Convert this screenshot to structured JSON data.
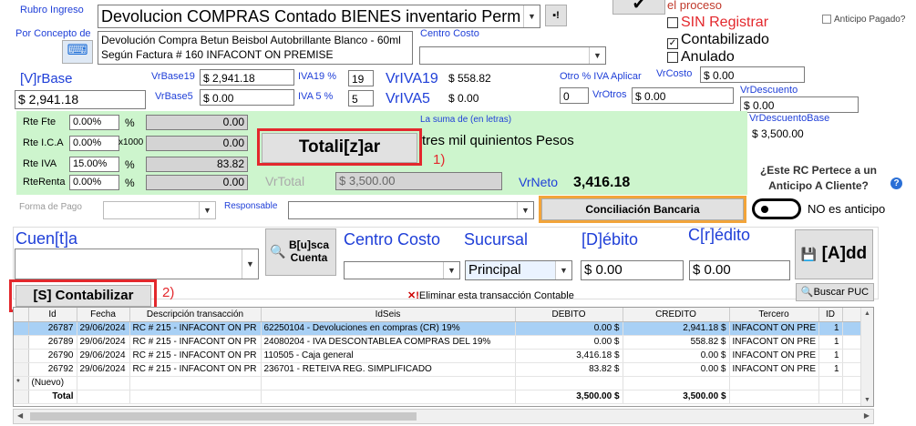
{
  "header": {
    "rubro_label": "Rubro Ingreso",
    "rubro_value": "Devolucion COMPRAS Contado BIENES inventario Perm",
    "por_concepto_label": "Por Concepto de",
    "concepto_text": "Devolución Compra Betun Beisbol Autobrillante Blanco - 60ml Según Factura # 160 INFACONT ON PREMISE",
    "centro_costo_label": "Centro Costo",
    "el_proceso": "el proceso",
    "sin_registrar": "SIN Registrar",
    "contabilizado": "Contabilizado",
    "anulado": "Anulado",
    "anticipo_pagado": "Anticipo Pagado?"
  },
  "values": {
    "vrbase_label": "[V]rBase",
    "vrbase_value": "$ 2,941.18",
    "vrbase19_label": "VrBase19",
    "vrbase19_value": "$ 2,941.18",
    "vrbase5_label": "VrBase5",
    "vrbase5_value": "$ 0.00",
    "iva19_label": "IVA19 %",
    "iva19_value": "19",
    "iva5_label": "IVA 5 %",
    "iva5_value": "5",
    "vriva19_label": "VrIVA19",
    "vriva19_value": "$ 558.82",
    "vriva5_label": "VrIVA5",
    "vriva5_value": "$ 0.00",
    "otro_iva_label": "Otro % IVA Aplicar",
    "otro_iva_value": "0",
    "vrcosto_label": "VrCosto",
    "vrcosto_value": "$ 0.00",
    "vrotros_label": "VrOtros",
    "vrotros_value": "$ 0.00",
    "vrdescuento_label": "VrDescuento",
    "vrdescuento_value": "$ 0.00",
    "vrdescuentobase_label": "VrDescuentoBase",
    "vrdescuentobase_value": "$ 3,500.00"
  },
  "retenciones": {
    "rte_fte_label": "Rte Fte",
    "rte_fte_pct": "0.00%",
    "rte_fte_val": "0.00",
    "rte_ica_label": "Rte I.C.A",
    "rte_ica_pct": "0.00%",
    "rte_ica_unit": "x1000",
    "rte_ica_val": "0.00",
    "rte_iva_label": "Rte IVA",
    "rte_iva_pct": "15.00%",
    "rte_iva_val": "83.82",
    "rte_renta_label": "RteRenta",
    "rte_renta_pct": "0.00%",
    "rte_renta_val": "0.00",
    "pct": "%"
  },
  "totales": {
    "totalizar_btn": "Totali[z]ar",
    "suma_letras_label": "La suma de (en letras)",
    "suma_letras": "tres mil quinientos Pesos",
    "annot1": "1)",
    "vrtotal_label": "VrTotal",
    "vrtotal_value": "$ 3,500.00",
    "vrneto_label": "VrNeto",
    "vrneto_value": "3,416.18"
  },
  "rc": {
    "question": "¿Este RC Pertece a un Anticipo A Cliente?",
    "toggle_label": "NO es anticipo",
    "help": "?"
  },
  "pago": {
    "forma_pago_label": "Forma de Pago",
    "responsable_label": "Responsable",
    "conciliacion_btn": "Conciliación Bancaria"
  },
  "entry": {
    "cuenta_label": "Cuen[t]a",
    "buscar_btn_1": "B[u]sca",
    "buscar_btn_2": "Cuenta",
    "centro_costo_label": "Centro Costo",
    "sucursal_label": "Sucursal",
    "sucursal_value": "Principal",
    "debito_label": "[D]ébito",
    "debito_value": "$ 0.00",
    "credito_label": "C[r]édito",
    "credito_value": "$ 0.00",
    "add_btn": "[A]dd"
  },
  "actions": {
    "contabilizar_btn": "[S] Contabilizar",
    "annot2": "2)",
    "eliminar": "Eliminar esta transacción Contable",
    "buscar_puc": "Buscar PUC"
  },
  "grid": {
    "headers": [
      "Id",
      "Fecha",
      "Descripción transacción",
      "IdSeis",
      "DEBITO",
      "CREDITO",
      "Tercero",
      "ID"
    ],
    "rows": [
      [
        "26787",
        "29/06/2024",
        "RC # 215 - INFACONT ON PR",
        "62250104 - Devoluciones en compras (CR) 19%",
        "0.00 $",
        "2,941.18 $",
        "INFACONT ON PRE",
        "1"
      ],
      [
        "26789",
        "29/06/2024",
        "RC # 215 - INFACONT ON PR",
        "24080204 - IVA DESCONTABLEA COMPRAS DEL 19%",
        "0.00 $",
        "558.82 $",
        "INFACONT ON PRE",
        "1"
      ],
      [
        "26790",
        "29/06/2024",
        "RC # 215 - INFACONT ON PR",
        "110505 - Caja general",
        "3,416.18 $",
        "0.00 $",
        "INFACONT ON PRE",
        "1"
      ],
      [
        "26792",
        "29/06/2024",
        "RC # 215 - INFACONT ON PR",
        "236701 - RETEIVA REG. SIMPLIFICADO",
        "83.82 $",
        "0.00 $",
        "INFACONT ON PRE",
        "1"
      ]
    ],
    "new_row": "(Nuevo)",
    "new_marker": "*",
    "total_label": "Total",
    "total_debito": "3,500.00 $",
    "total_credito": "3,500.00 $"
  }
}
